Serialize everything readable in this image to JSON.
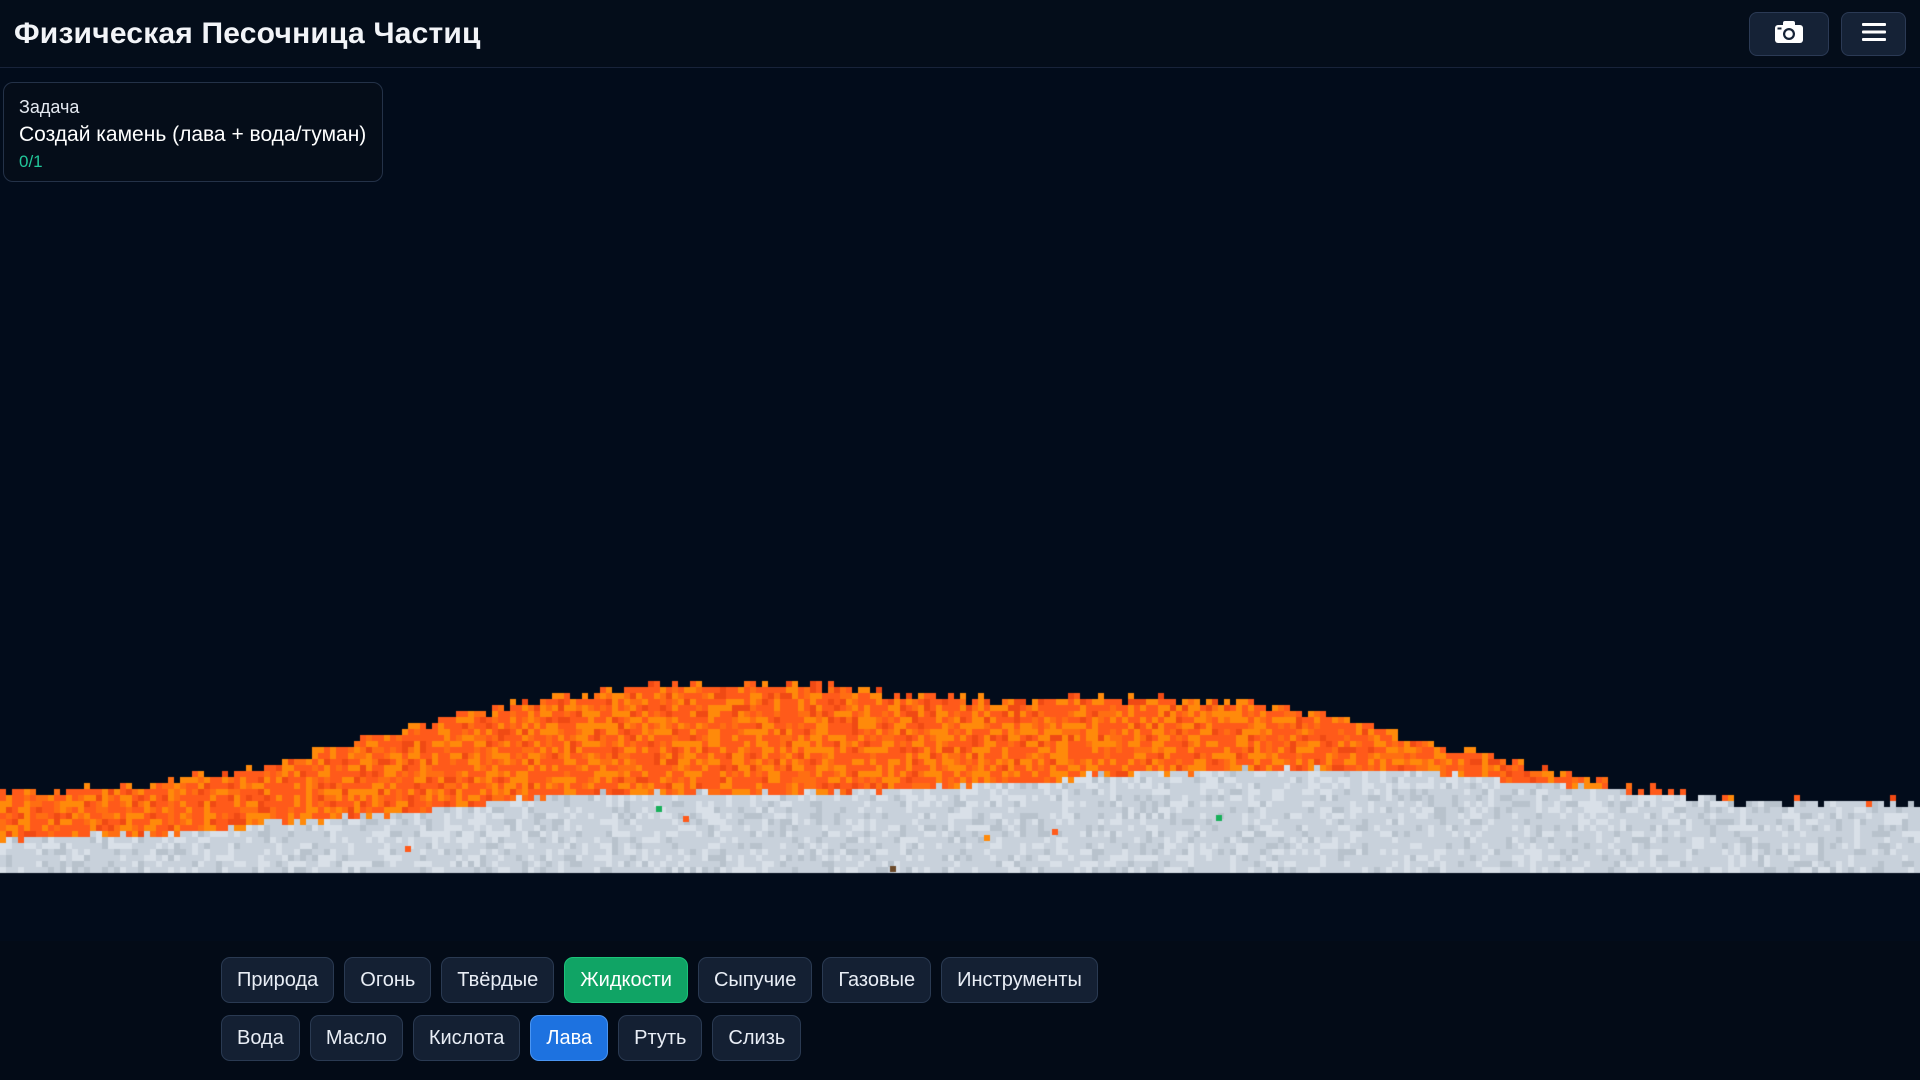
{
  "app": {
    "title": "Физическая Песочница Частиц"
  },
  "toolbar": {
    "camera_icon": "camera-icon",
    "menu_icon": "hamburger-menu-icon"
  },
  "task": {
    "heading": "Задача",
    "text": "Создай камень (лава + вода/туман)",
    "progress": "0/1"
  },
  "categories": [
    {
      "label": "Природа",
      "active": false
    },
    {
      "label": "Огонь",
      "active": false
    },
    {
      "label": "Твёрдые",
      "active": false
    },
    {
      "label": "Жидкости",
      "active": true
    },
    {
      "label": "Сыпучие",
      "active": false
    },
    {
      "label": "Газовые",
      "active": false
    },
    {
      "label": "Инструменты",
      "active": false
    }
  ],
  "elements": [
    {
      "label": "Вода",
      "active": false
    },
    {
      "label": "Масло",
      "active": false
    },
    {
      "label": "Кислота",
      "active": false
    },
    {
      "label": "Лава",
      "active": true
    },
    {
      "label": "Ртуть",
      "active": false
    },
    {
      "label": "Слизь",
      "active": false
    }
  ],
  "colors": {
    "background": "#020c1b",
    "lava": [
      "#ff5a1a",
      "#ff8a0a",
      "#ff6e12",
      "#f04a14"
    ],
    "stone": [
      "#c8d1db",
      "#d9e0e8",
      "#b8c2cc"
    ],
    "category_active": "#10a465",
    "element_active": "#1d72e0",
    "progress": "#22c69a"
  }
}
